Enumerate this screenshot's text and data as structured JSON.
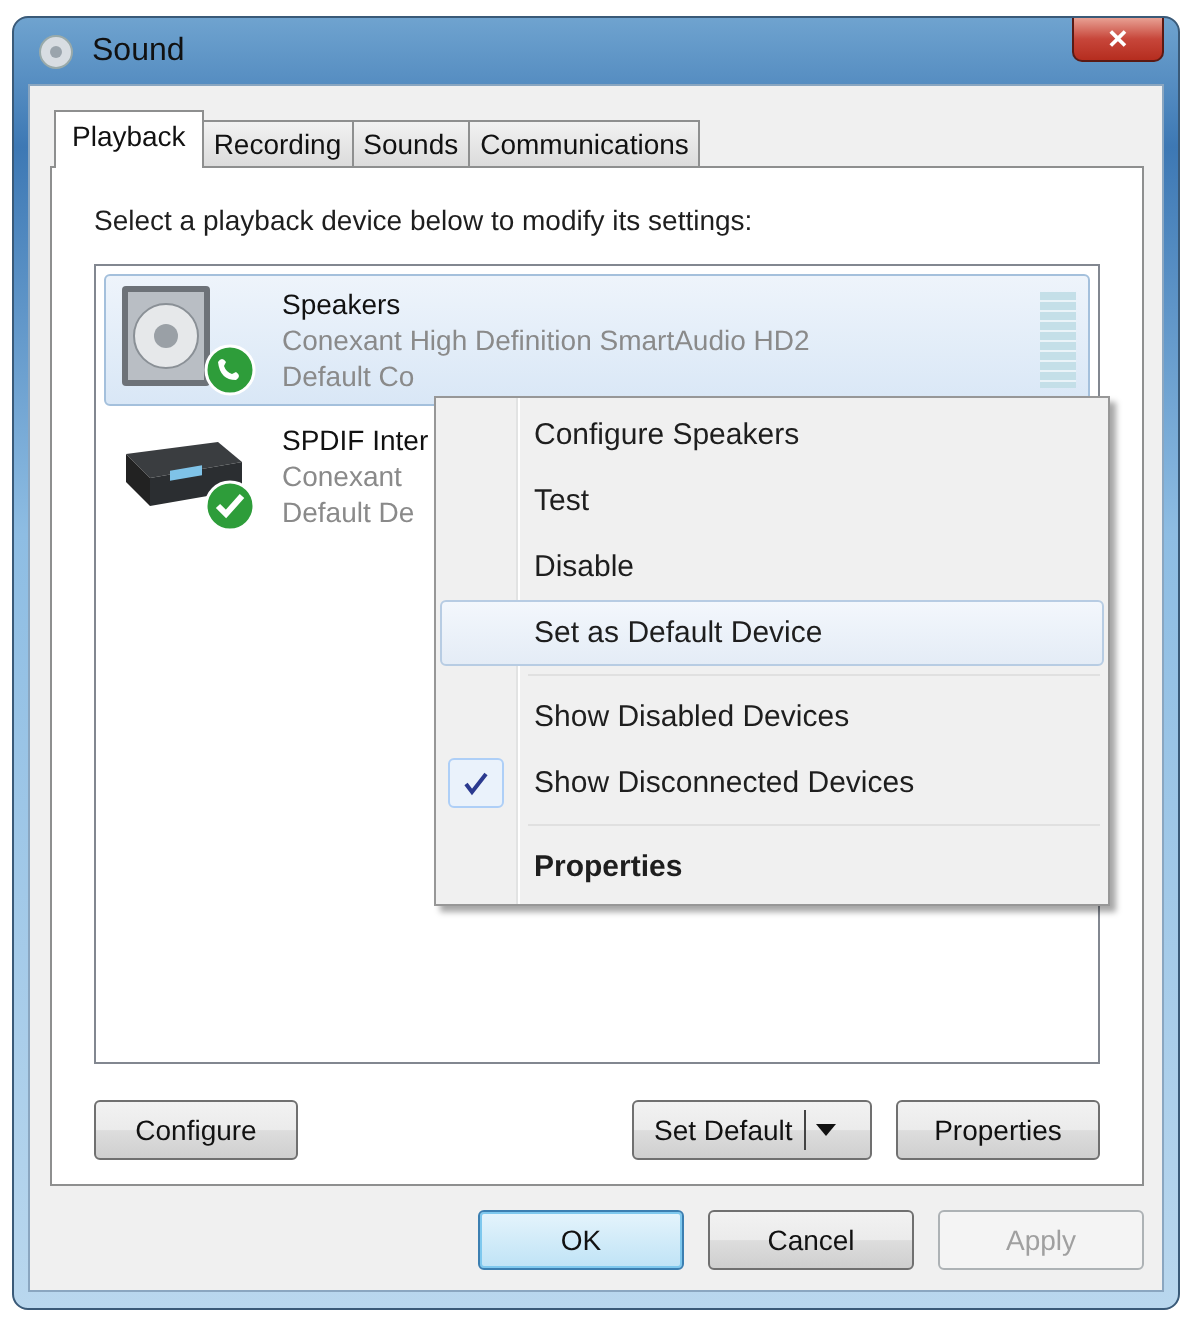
{
  "window": {
    "title": "Sound",
    "close": "✕"
  },
  "tabs": [
    {
      "label": "Playback",
      "selected": true
    },
    {
      "label": "Recording",
      "selected": false
    },
    {
      "label": "Sounds",
      "selected": false
    },
    {
      "label": "Communications",
      "selected": false
    }
  ],
  "instruction": "Select a playback device below to modify its settings:",
  "devices": [
    {
      "kind": "speakers",
      "name": "Speakers",
      "description": "Conexant High Definition SmartAudio HD2",
      "status": "Default Co",
      "selected": true,
      "level": 0
    },
    {
      "kind": "digital",
      "name": "SPDIF Inter",
      "description": "Conexant",
      "status": "Default De",
      "selected": false
    }
  ],
  "panel_buttons": [
    {
      "label": "Configure",
      "kind": "plain"
    },
    {
      "label": "Set Default",
      "kind": "split"
    },
    {
      "label": "Properties",
      "kind": "plain"
    }
  ],
  "dialog_buttons": [
    {
      "label": "OK",
      "default": true,
      "disabled": false
    },
    {
      "label": "Cancel",
      "default": false,
      "disabled": false
    },
    {
      "label": "Apply",
      "default": false,
      "disabled": true
    }
  ],
  "context_menu": [
    {
      "kind": "item",
      "label": "Configure Speakers",
      "selected": false,
      "checked": false,
      "bold": false
    },
    {
      "kind": "item",
      "label": "Test",
      "selected": false,
      "checked": false,
      "bold": false
    },
    {
      "kind": "item",
      "label": "Disable",
      "selected": false,
      "checked": false,
      "bold": false
    },
    {
      "kind": "item",
      "label": "Set as Default Device",
      "selected": true,
      "checked": false,
      "bold": false
    },
    {
      "kind": "separator"
    },
    {
      "kind": "item",
      "label": "Show Disabled Devices",
      "selected": false,
      "checked": false,
      "bold": false
    },
    {
      "kind": "item",
      "label": "Show Disconnected Devices",
      "selected": false,
      "checked": true,
      "bold": false
    },
    {
      "kind": "separator"
    },
    {
      "kind": "item",
      "label": "Properties",
      "selected": false,
      "checked": false,
      "bold": true
    }
  ]
}
